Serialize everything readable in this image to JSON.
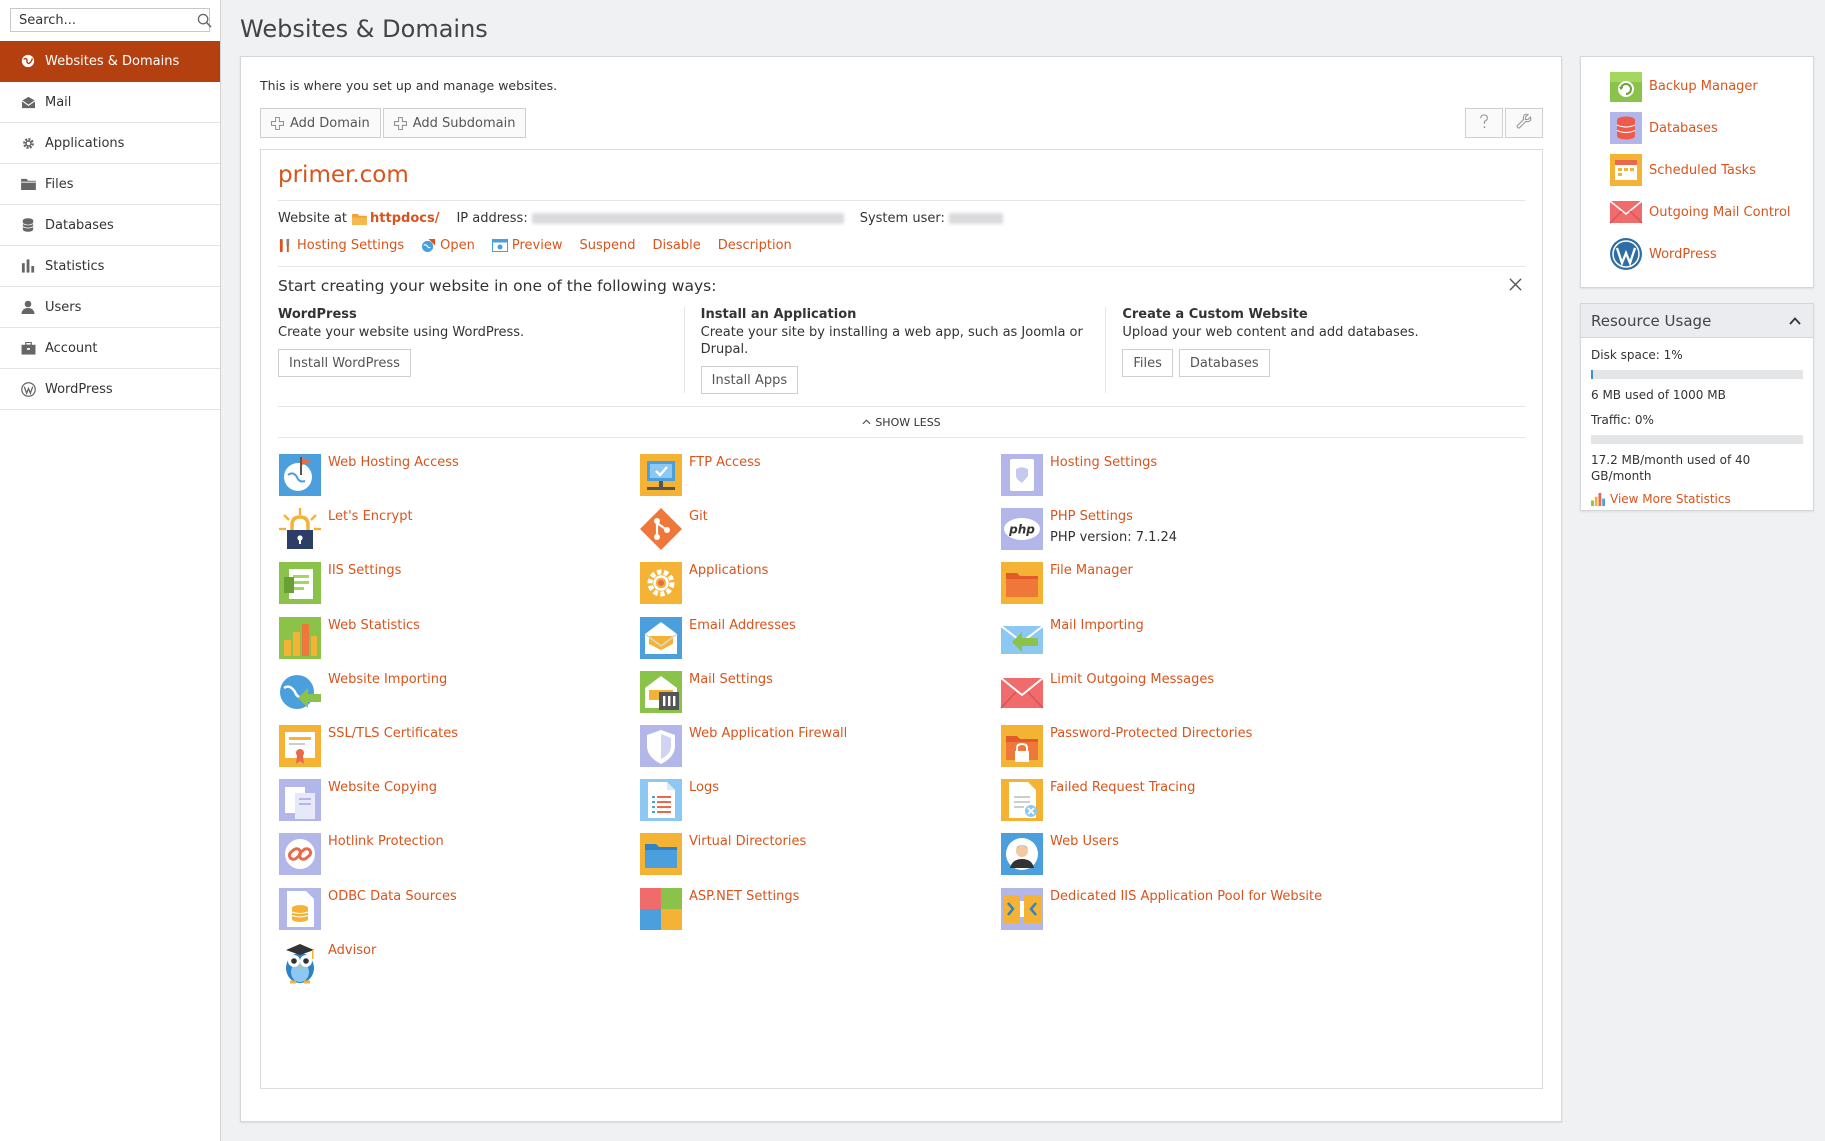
{
  "search": {
    "placeholder": "Search..."
  },
  "nav": [
    {
      "label": "Websites & Domains",
      "icon": "globe-icon",
      "active": true
    },
    {
      "label": "Mail",
      "icon": "mail-icon"
    },
    {
      "label": "Applications",
      "icon": "gear-icon"
    },
    {
      "label": "Files",
      "icon": "folder-icon"
    },
    {
      "label": "Databases",
      "icon": "database-icon"
    },
    {
      "label": "Statistics",
      "icon": "bar-chart-icon"
    },
    {
      "label": "Users",
      "icon": "user-icon"
    },
    {
      "label": "Account",
      "icon": "briefcase-icon"
    },
    {
      "label": "WordPress",
      "icon": "wordpress-icon"
    }
  ],
  "page": {
    "title": "Websites & Domains",
    "intro": "This is where you set up and manage websites."
  },
  "toolbar": {
    "add_domain": "Add Domain",
    "add_subdomain": "Add Subdomain"
  },
  "domain": {
    "name": "primer.com",
    "website_at_label": "Website at",
    "website_path": "httpdocs/",
    "ip_label": "IP address:",
    "system_user_label": "System user:",
    "actions": [
      "Hosting Settings",
      "Open",
      "Preview",
      "Suspend",
      "Disable",
      "Description"
    ]
  },
  "start": {
    "title": "Start creating your website in one of the following ways:",
    "ways": [
      {
        "title": "WordPress",
        "desc": "Create your website using WordPress.",
        "buttons": [
          "Install WordPress"
        ]
      },
      {
        "title": "Install an Application",
        "desc": "Create your site by installing a web app, such as Joomla or Drupal.",
        "buttons": [
          "Install Apps"
        ]
      },
      {
        "title": "Create a Custom Website",
        "desc": "Upload your web content and add databases.",
        "buttons": [
          "Files",
          "Databases"
        ]
      }
    ],
    "show_less": "SHOW LESS"
  },
  "tools": [
    {
      "label": "Web Hosting Access",
      "icon": "web-hosting-access-icon"
    },
    {
      "label": "FTP Access",
      "icon": "ftp-access-icon"
    },
    {
      "label": "Hosting Settings",
      "icon": "hosting-settings-icon"
    },
    {
      "label": "Let's Encrypt",
      "icon": "lets-encrypt-icon"
    },
    {
      "label": "Git",
      "icon": "git-icon"
    },
    {
      "label": "PHP Settings",
      "icon": "php-icon",
      "sub": "PHP version: 7.1.24"
    },
    {
      "label": "IIS Settings",
      "icon": "iis-settings-icon"
    },
    {
      "label": "Applications",
      "icon": "applications-icon"
    },
    {
      "label": "File Manager",
      "icon": "file-manager-icon"
    },
    {
      "label": "Web Statistics",
      "icon": "web-statistics-icon"
    },
    {
      "label": "Email Addresses",
      "icon": "email-addresses-icon"
    },
    {
      "label": "Mail Importing",
      "icon": "mail-importing-icon"
    },
    {
      "label": "Website Importing",
      "icon": "website-importing-icon"
    },
    {
      "label": "Mail Settings",
      "icon": "mail-settings-icon"
    },
    {
      "label": "Limit Outgoing Messages",
      "icon": "limit-outgoing-icon"
    },
    {
      "label": "SSL/TLS Certificates",
      "icon": "certificate-icon"
    },
    {
      "label": "Web Application Firewall",
      "icon": "shield-icon"
    },
    {
      "label": "Password-Protected Directories",
      "icon": "protected-folder-icon"
    },
    {
      "label": "Website Copying",
      "icon": "website-copying-icon"
    },
    {
      "label": "Logs",
      "icon": "logs-icon"
    },
    {
      "label": "Failed Request Tracing",
      "icon": "failed-request-icon"
    },
    {
      "label": "Hotlink Protection",
      "icon": "hotlink-protection-icon"
    },
    {
      "label": "Virtual Directories",
      "icon": "virtual-directories-icon"
    },
    {
      "label": "Web Users",
      "icon": "web-users-icon"
    },
    {
      "label": "ODBC Data Sources",
      "icon": "odbc-icon"
    },
    {
      "label": "ASP.NET Settings",
      "icon": "aspnet-icon"
    },
    {
      "label": "Dedicated IIS Application Pool for Website",
      "icon": "app-pool-icon"
    },
    {
      "label": "Advisor",
      "icon": "owl-advisor-icon"
    }
  ],
  "shortcuts": [
    {
      "label": "Backup Manager",
      "icon": "backup-icon"
    },
    {
      "label": "Databases",
      "icon": "database-icon"
    },
    {
      "label": "Scheduled Tasks",
      "icon": "calendar-icon"
    },
    {
      "label": "Outgoing Mail Control",
      "icon": "outgoing-mail-icon"
    },
    {
      "label": "WordPress",
      "icon": "wordpress-icon"
    }
  ],
  "resource": {
    "title": "Resource Usage",
    "disk_label": "Disk space: 1%",
    "disk_fraction": 0.01,
    "disk_detail": "6 MB used of 1000 MB",
    "traffic_label": "Traffic: 0%",
    "traffic_fraction": 0.0,
    "traffic_detail": "17.2 MB/month used of 40 GB/month",
    "view_more": "View More Statistics"
  },
  "colors": {
    "accent": "#d8541c",
    "active_nav": "#b5400f"
  }
}
